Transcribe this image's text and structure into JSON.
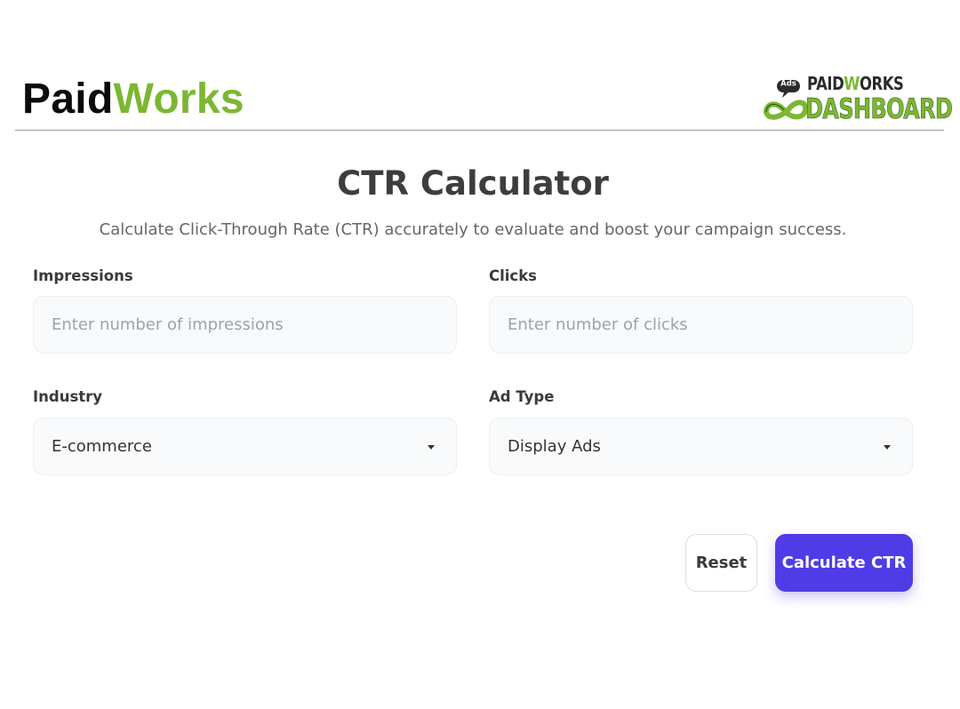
{
  "header": {
    "brand_part1": "Paid",
    "brand_part2": "Works",
    "logo": {
      "badge": "Ads",
      "top_part1": "PAID",
      "top_part2": "W",
      "top_part3": "ORKS",
      "bottom": "DASHBOARD"
    }
  },
  "calculator": {
    "title": "CTR Calculator",
    "subtitle": "Calculate Click-Through Rate (CTR) accurately to evaluate and boost your campaign success.",
    "fields": {
      "impressions": {
        "label": "Impressions",
        "placeholder": "Enter number of impressions",
        "value": ""
      },
      "clicks": {
        "label": "Clicks",
        "placeholder": "Enter number of clicks",
        "value": ""
      },
      "industry": {
        "label": "Industry",
        "selected": "E-commerce"
      },
      "ad_type": {
        "label": "Ad Type",
        "selected": "Display Ads"
      }
    },
    "buttons": {
      "reset": "Reset",
      "calculate": "Calculate CTR"
    }
  },
  "colors": {
    "brand_green": "#7cb733",
    "primary_button": "#4f3ce6",
    "field_bg": "#f8fafb"
  },
  "icons": {
    "logo_mark": "infinity-loop-icon",
    "select_caret": "caret-down-icon"
  }
}
